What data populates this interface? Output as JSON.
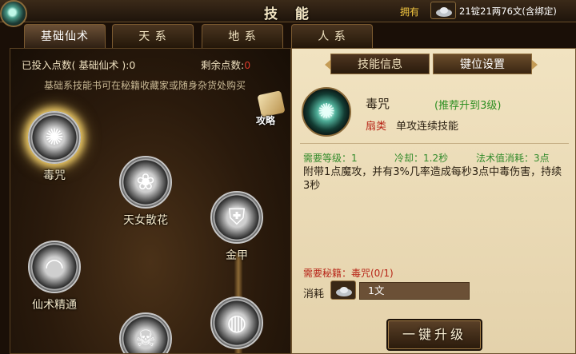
{
  "window": {
    "title": "技 能",
    "money_label": "拥有",
    "money_amount": "21锭21两76文",
    "money_note": "(含绑定)"
  },
  "tabs": [
    {
      "label": "基础仙术",
      "active": true
    },
    {
      "label": "天 系",
      "active": false
    },
    {
      "label": "地 系",
      "active": false
    },
    {
      "label": "人 系",
      "active": false
    }
  ],
  "left": {
    "invested_label": "已投入点数( 基础仙术 ):",
    "invested_value": "0",
    "remaining_label": "剩余点数:",
    "remaining_value": "0",
    "hint": "基础系技能书可在秘籍收藏家或随身杂货处购买",
    "guide_label": "攻略"
  },
  "skills": [
    {
      "name": "毒咒",
      "icon": "spider-icon",
      "selected": true
    },
    {
      "name": "天女散花",
      "icon": "flower-icon",
      "selected": false
    },
    {
      "name": "金甲",
      "icon": "armor-icon",
      "selected": false
    },
    {
      "name": "仙术精通",
      "icon": "fan-icon",
      "selected": false
    },
    {
      "name": "",
      "icon": "skull-icon",
      "selected": false
    },
    {
      "name": "",
      "icon": "cave-icon",
      "selected": false
    }
  ],
  "right": {
    "tabs": [
      {
        "label": "技能信息",
        "active": false
      },
      {
        "label": "键位设置",
        "active": true
      }
    ],
    "skill_name": "毒咒",
    "recommend": "(推荐升到3级)",
    "school": "扇类",
    "short_desc": "单攻连续技能",
    "level_req": "需要等级：1",
    "cooldown": "冷却：1.2秒",
    "mana_cost": "法术值消耗：3点",
    "description": "附带1点魔攻，并有3%几率造成每秒3点中毒伤害，持续3秒",
    "book_req": "需要秘籍：毒咒(0/1)",
    "consume_label": "消耗",
    "consume_value": "1文",
    "upgrade_button": "一键升级"
  },
  "colors": {
    "accent_gold": "#f2c640",
    "positive_green": "#318a2a",
    "warning_red": "#b72417",
    "panel_bg": "#f1e3c1"
  }
}
